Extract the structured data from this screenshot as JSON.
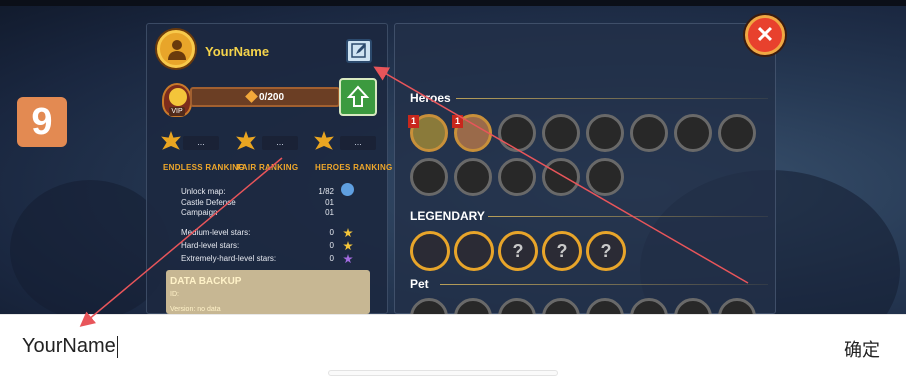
{
  "step_badge": "9",
  "profile": {
    "name": "YourName",
    "vip": {
      "label": "VIP",
      "progress_text": "0/200",
      "progress": 0.0
    }
  },
  "rankings": [
    {
      "label": "ENDLESS RANKING",
      "value": "..."
    },
    {
      "label": "FAIR RANKING",
      "value": "..."
    },
    {
      "label": "HEROES RANKING",
      "value": "..."
    }
  ],
  "stats": {
    "unlock_map": {
      "label": "Unlock map:",
      "value": "1/82"
    },
    "castle_defense": {
      "label": "Castle Defense",
      "value": "01"
    },
    "campaign": {
      "label": "Campaign",
      "value": "01"
    },
    "medium_stars": {
      "label": "Medium-level stars:",
      "value": "0"
    },
    "hard_stars": {
      "label": "Hard-level stars:",
      "value": "0"
    },
    "extreme_stars": {
      "label": "Extremely-hard-level stars:",
      "value": "0"
    }
  },
  "backup": {
    "title": "DATA BACKUP",
    "id_label": "ID:",
    "version_label": "Version: no data"
  },
  "sections": {
    "heroes": "Heroes",
    "legendary": "LEGENDARY",
    "pet": "Pet"
  },
  "heroes": {
    "unlocked_levels": [
      "1",
      "1"
    ]
  },
  "input": {
    "value": "YourName",
    "confirm_label": "确定"
  },
  "colors": {
    "accent_gold": "#f4d34b",
    "close_red": "#e8412d",
    "vip_green": "#5fbf35",
    "arrow": "#e8555a"
  },
  "icons": [
    "avatar-icon",
    "edit-icon",
    "vip-face-icon",
    "upgrade-arrow-icon",
    "close-icon",
    "medal-icon",
    "globe-icon",
    "star-icon",
    "question-icon"
  ]
}
